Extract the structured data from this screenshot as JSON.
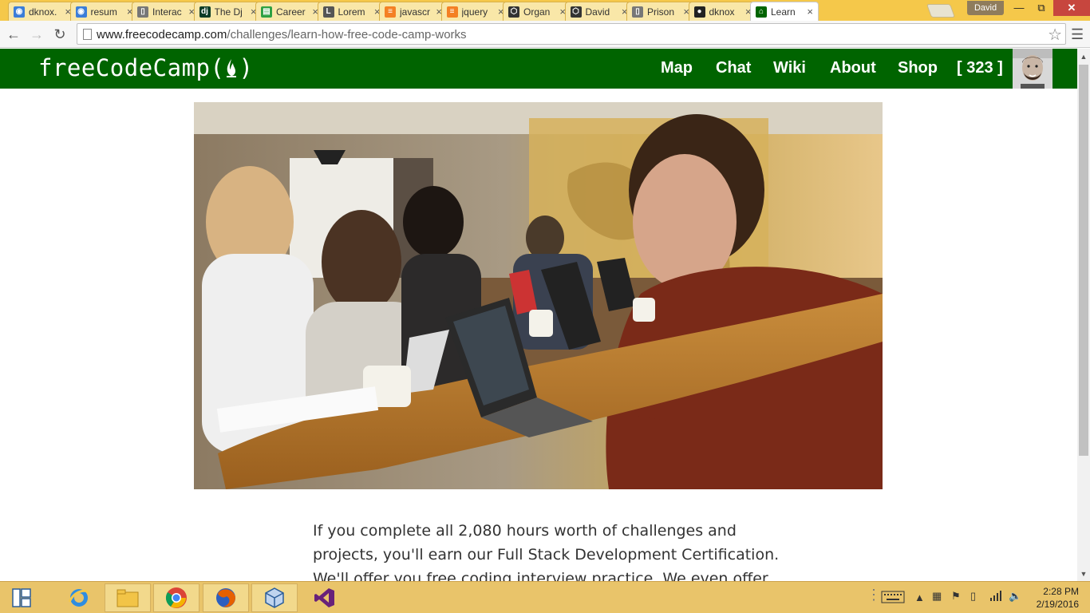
{
  "browser": {
    "tabs": [
      {
        "label": "dknox.",
        "icon": "view-icon",
        "color": "#3b7dd8"
      },
      {
        "label": "resum",
        "icon": "view-icon",
        "color": "#3b7dd8"
      },
      {
        "label": "Interac",
        "icon": "document-icon",
        "color": "#777777"
      },
      {
        "label": "The Dj",
        "icon": "django-icon",
        "color": "#0c3c26"
      },
      {
        "label": "Career",
        "icon": "trello-icon",
        "color": "#2ea043"
      },
      {
        "label": "Lorem",
        "icon": "lorem-icon",
        "color": "#555555"
      },
      {
        "label": "javascr",
        "icon": "stackoverflow-icon",
        "color": "#f48024"
      },
      {
        "label": "jquery",
        "icon": "stackoverflow-icon",
        "color": "#f48024"
      },
      {
        "label": "Organ",
        "icon": "codepen-icon",
        "color": "#333333"
      },
      {
        "label": "David",
        "icon": "codepen-icon",
        "color": "#333333"
      },
      {
        "label": "Prison",
        "icon": "document-icon",
        "color": "#777777"
      },
      {
        "label": "dknox",
        "icon": "github-icon",
        "color": "#222222"
      },
      {
        "label": "Learn",
        "icon": "fcc-icon",
        "color": "#006400",
        "active": true
      }
    ],
    "profile_name": "David",
    "url_domain": "www.freecodecamp.com",
    "url_path": "/challenges/learn-how-free-code-camp-works"
  },
  "fcc": {
    "logo": "freeCodeCamp(🔥)",
    "logo_text": "freeCodeCamp(",
    "logo_close": ")",
    "nav": [
      "Map",
      "Chat",
      "Wiki",
      "About",
      "Shop"
    ],
    "points": "[ 323 ]",
    "brand_color": "#006400"
  },
  "content": {
    "paragraph_lines": [
      "If you complete all 2,080 hours worth of challenges and",
      "projects, you'll earn our Full Stack Development Certification.",
      "We'll offer you free coding interview practice. We even offer"
    ]
  },
  "taskbar": {
    "time": "2:28 PM",
    "date": "2/19/2016"
  }
}
